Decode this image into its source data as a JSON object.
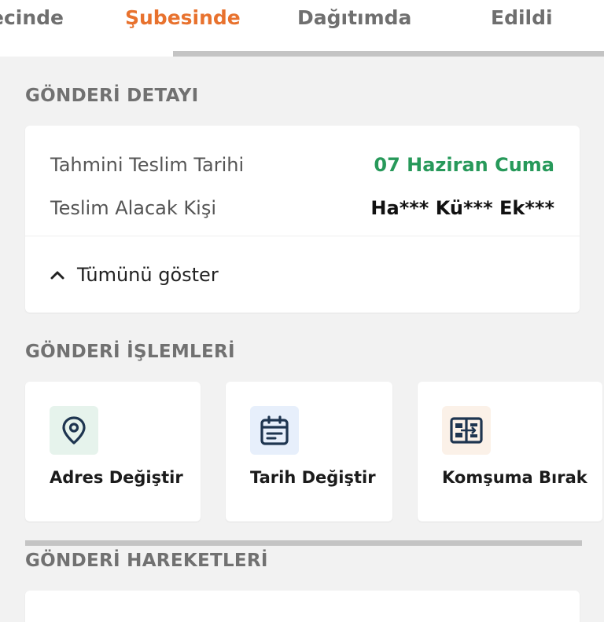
{
  "tabs": [
    {
      "label": "ecinde",
      "active": false
    },
    {
      "label": "Şubesinde",
      "active": true
    },
    {
      "label": "Dağıtımda",
      "active": false
    },
    {
      "label": "Edildi",
      "active": false
    }
  ],
  "colors": {
    "accent": "#e8722e",
    "green": "#27995a",
    "navy": "#1e3550"
  },
  "detail": {
    "section_title": "GÖNDERİ DETAYI",
    "rows": [
      {
        "label": "Tahmini Teslim Tarihi",
        "value": "07 Haziran Cuma"
      },
      {
        "label": "Teslim Alacak Kişi",
        "value": "Ha*** Kü*** Ek***"
      }
    ],
    "show_all_label": "Tümünü göster",
    "show_all_icon": "chevron-up-icon"
  },
  "actions": {
    "section_title": "GÖNDERİ İŞLEMLERİ",
    "items": [
      {
        "label": "Adres Değiştir",
        "icon": "location-pin-icon"
      },
      {
        "label": "Tarih Değiştir",
        "icon": "calendar-icon"
      },
      {
        "label": "Komşuma Bırak",
        "icon": "neighbor-transfer-icon"
      }
    ]
  },
  "movements": {
    "section_title": "GÖNDERİ HAREKETLERİ"
  }
}
